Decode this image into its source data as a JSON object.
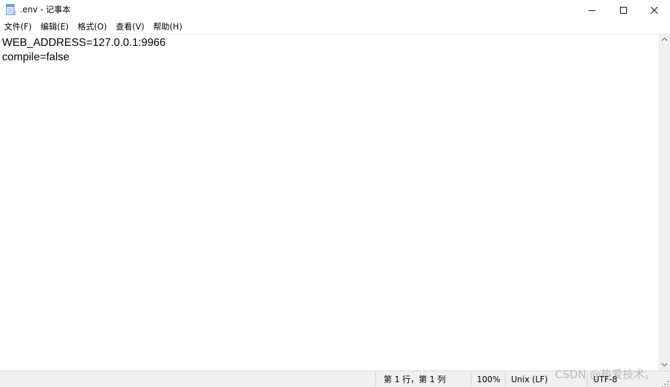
{
  "window": {
    "title": ".env - 记事本",
    "icon": "notepad-icon",
    "controls": {
      "minimize": "minimize-icon",
      "maximize": "maximize-icon",
      "close": "close-icon"
    }
  },
  "menu": {
    "items": [
      {
        "label": "文件(F)"
      },
      {
        "label": "编辑(E)"
      },
      {
        "label": "格式(O)"
      },
      {
        "label": "查看(V)"
      },
      {
        "label": "帮助(H)"
      }
    ]
  },
  "editor": {
    "lines": [
      "WEB_ADDRESS=127.0.0.1:9966",
      "compile=false"
    ]
  },
  "statusbar": {
    "position": "第 1 行，第 1 列",
    "zoom": "100%",
    "line_ending": "Unix (LF)",
    "encoding": "UTF-8"
  },
  "watermark": {
    "text": "CSDN @热爱技术。"
  }
}
